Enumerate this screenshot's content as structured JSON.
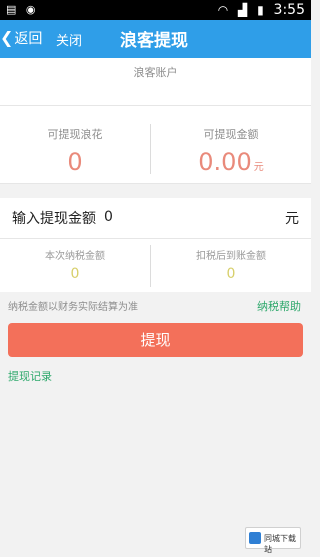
{
  "statusbar": {
    "icons": [
      "notification-icon",
      "circle-icon",
      "wifi-icon",
      "signal-icon",
      "battery-icon"
    ],
    "time": "3:55"
  },
  "titlebar": {
    "back_label": "返回",
    "close_label": "关闭",
    "title": "浪客提现",
    "background": "#2f9ee8"
  },
  "account": {
    "label": "浪客账户"
  },
  "balances": {
    "left_label": "可提现浪花",
    "left_value": "0",
    "right_label": "可提现金额",
    "right_value": "0.00",
    "right_unit": "元"
  },
  "amount": {
    "label": "输入提现金额",
    "value": "0",
    "unit": "元"
  },
  "tax": {
    "left_label": "本次纳税金额",
    "left_value": "0",
    "right_label": "扣税后到账金额",
    "right_value": "0"
  },
  "note": "纳税金额以财务实际结算为准",
  "help_link": "纳税帮助",
  "withdraw_button": "提现",
  "records_link": "提现记录",
  "watermark": "同城下载站",
  "colors": {
    "accent": "#2f9ee8",
    "button": "#f3705a",
    "link": "#2da86b",
    "value": "#e98a7b"
  }
}
